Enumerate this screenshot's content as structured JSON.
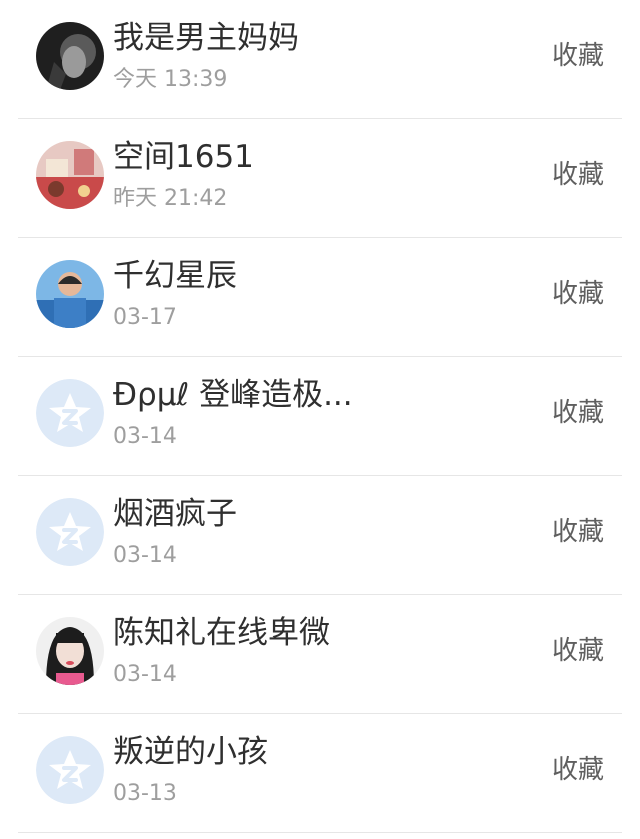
{
  "colors": {
    "name": "#2f2f2f",
    "time": "#9e9e9e",
    "action": "#5f5f5f",
    "divider": "#e6e6e6"
  },
  "items": [
    {
      "name": "我是男主妈妈",
      "time": "今天 13:39",
      "action": "收藏",
      "avatar_icon": "dark-portrait-avatar"
    },
    {
      "name": "空间1651",
      "time": "昨天 21:42",
      "action": "收藏",
      "avatar_icon": "colorful-photo-avatar"
    },
    {
      "name": "千幻星辰",
      "time": "03-17",
      "action": "收藏",
      "avatar_icon": "boy-photo-avatar"
    },
    {
      "name": "Ɖρμℓ 登峰造极...",
      "time": "03-14",
      "action": "收藏",
      "avatar_icon": "default-qzone-star-avatar"
    },
    {
      "name": "烟酒疯子",
      "time": "03-14",
      "action": "收藏",
      "avatar_icon": "default-qzone-star-avatar"
    },
    {
      "name": "陈知礼在线卑微",
      "time": "03-14",
      "action": "收藏",
      "avatar_icon": "girl-portrait-avatar"
    },
    {
      "name": "叛逆的小孩",
      "time": "03-13",
      "action": "收藏",
      "avatar_icon": "default-qzone-star-avatar"
    }
  ]
}
